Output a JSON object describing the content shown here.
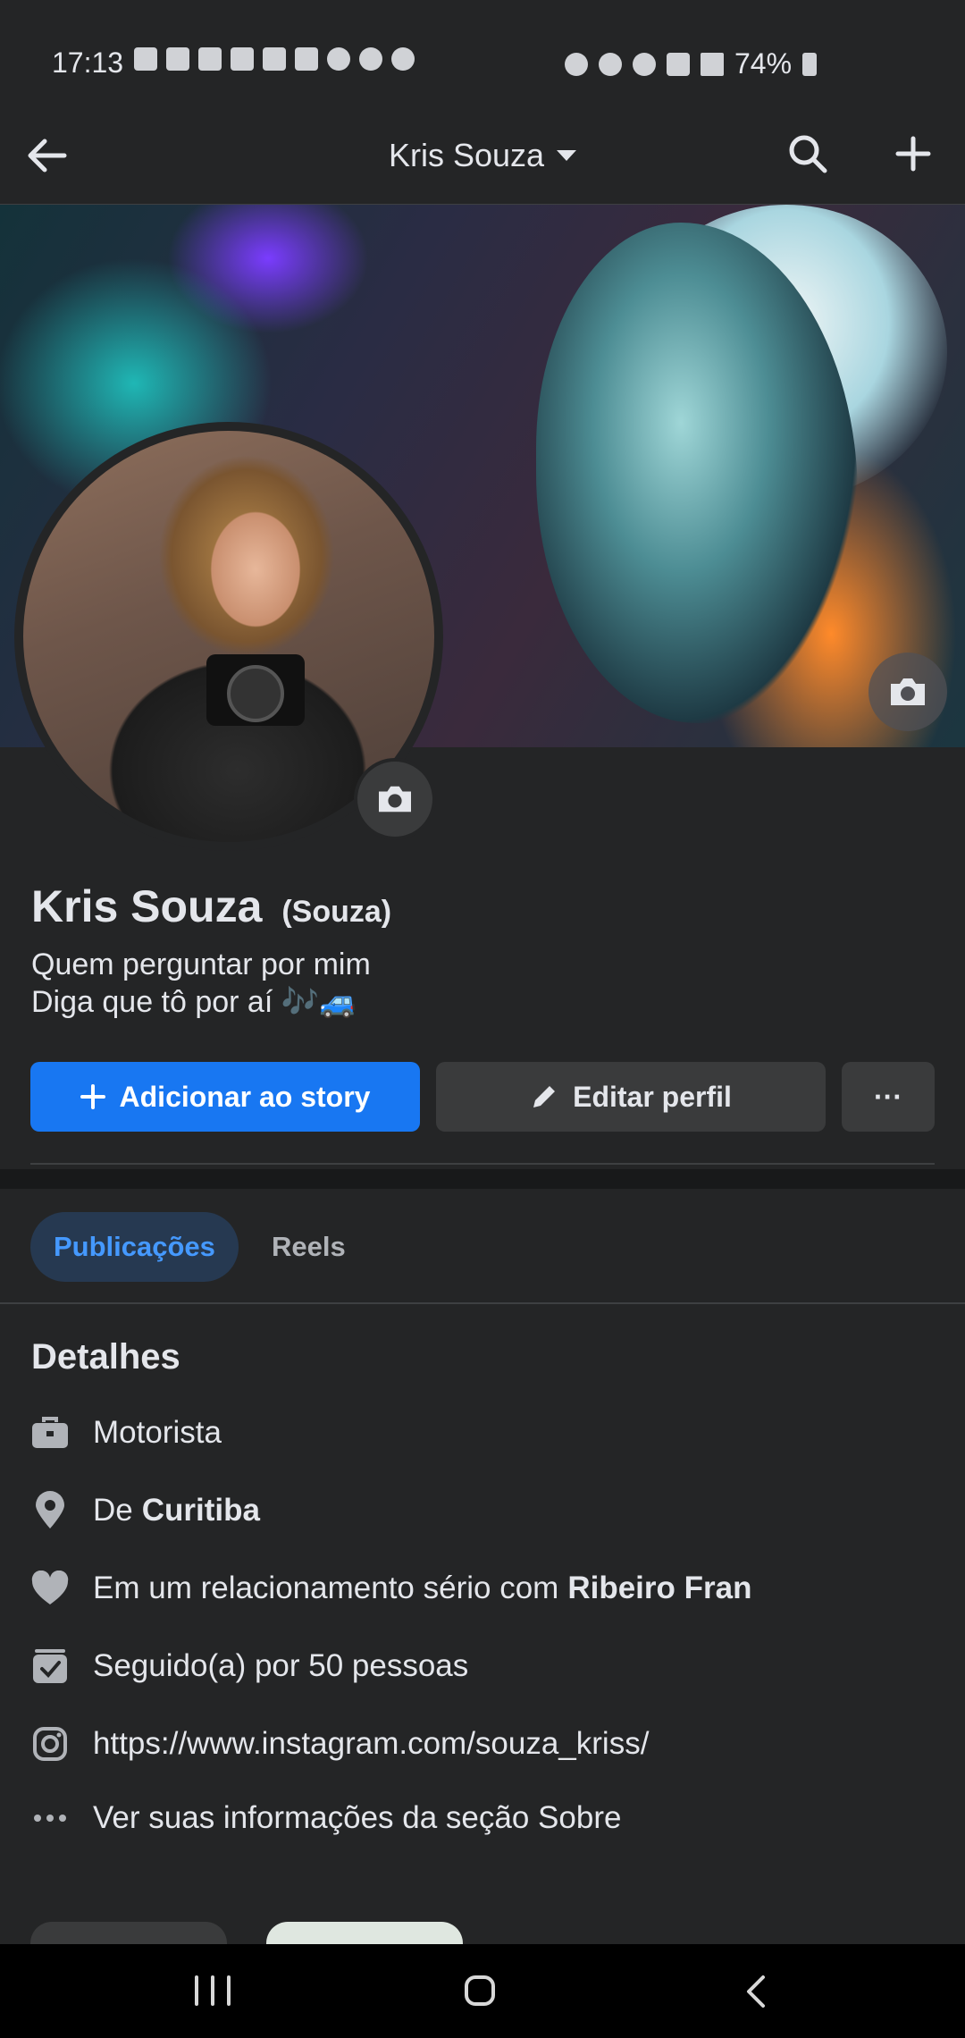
{
  "status_bar": {
    "time": "17:13",
    "battery": "74%",
    "left_icons": [
      "facebook-icon",
      "amazon-icon",
      "mail-icon",
      "facebook-icon",
      "instagram-icon",
      "ifood-icon",
      "messenger-icon",
      "check-icon",
      "fingerprint-icon"
    ],
    "right_icons": [
      "battery-saver-icon",
      "alarm-icon",
      "wifi-icon",
      "volte-icon",
      "signal-icon"
    ]
  },
  "top_nav": {
    "title": "Kris Souza"
  },
  "profile": {
    "name": "Kris Souza",
    "alternate_name": "(Souza)",
    "bio_line1": "Quem perguntar por mim",
    "bio_line2": "Diga que tô por aí 🎶🚙"
  },
  "actions": {
    "add_story": "Adicionar ao story",
    "edit_profile": "Editar perfil",
    "more": "···"
  },
  "tabs": [
    {
      "label": "Publicações",
      "active": true
    },
    {
      "label": "Reels",
      "active": false
    }
  ],
  "details": {
    "title": "Detalhes",
    "work": "Motorista",
    "hometown_prefix": "De",
    "hometown": "Curitiba",
    "relationship_prefix": "Em um relacionamento sério com",
    "relationship_partner": "Ribeiro Fran",
    "followers": "Seguido(a) por 50 pessoas",
    "instagram": "https://www.instagram.com/souza_kriss/",
    "about": "Ver suas informações da seção Sobre"
  },
  "colors": {
    "background": "#242526",
    "primary_button": "#1877f2",
    "secondary_button": "#3a3b3c",
    "active_tab_bg": "#263951",
    "active_tab_text": "#4599ff"
  }
}
